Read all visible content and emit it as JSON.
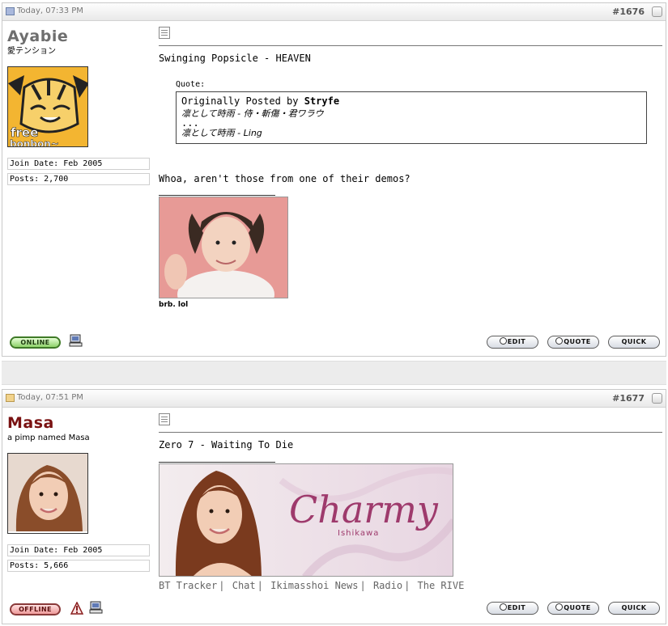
{
  "posts": [
    {
      "date": "Today, 07:33 PM",
      "number": "#1676",
      "username": "Ayabie",
      "usertitle": "愛テンション",
      "join_date": "Join Date: Feb 2005",
      "posts_count": "Posts: 2,700",
      "avatar_text": "free",
      "avatar_text2": "bonbon~",
      "message_line": "Swinging Popsicle - HEAVEN",
      "quote": {
        "label": "Quote:",
        "originally_posted_by": "Originally Posted by",
        "author": "Stryfe",
        "line1": "凛として時雨 - 侍・斬傷・君ワラウ",
        "line2": "...",
        "line3": "凛として時雨 - Ling"
      },
      "reply_text": "Whoa, aren't those from one of their demos?",
      "image_caption": "brb. lol",
      "status": "ONLINE",
      "buttons": {
        "edit": "EDIT",
        "quote": "QUOTE",
        "quick": "QUICK"
      }
    },
    {
      "date": "Today, 07:51 PM",
      "number": "#1677",
      "username": "Masa",
      "usertitle": "a pimp named Masa",
      "join_date": "Join Date: Feb 2005",
      "posts_count": "Posts: 5,666",
      "message_line": "Zero 7 - Waiting To Die",
      "banner_title": "Charmy",
      "banner_subtitle": "Ishikawa",
      "signature_links": [
        "BT Tracker",
        "Chat",
        "Ikimasshoi News",
        "Radio",
        "The RIVE"
      ],
      "status": "OFFLINE",
      "buttons": {
        "edit": "EDIT",
        "quote": "QUOTE",
        "quick": "QUICK"
      }
    }
  ],
  "colors": {
    "username1": "#6e6e6e",
    "username2": "#7a1212",
    "online": "#8ed26a",
    "offline": "#ee9a9a"
  }
}
